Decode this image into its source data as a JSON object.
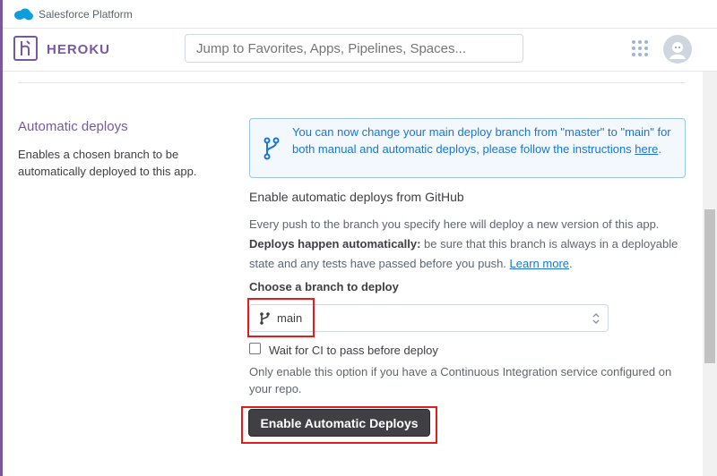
{
  "salesforce_bar": {
    "title": "Salesforce Platform",
    "icon": "salesforce-cloud-icon",
    "color": "#0d9dda"
  },
  "heroku_header": {
    "brand": "HEROKU",
    "logo_icon": "heroku-logo-icon",
    "brand_color": "#79589f",
    "search": {
      "placeholder": "Jump to Favorites, Apps, Pipelines, Spaces..."
    },
    "apps_icon": "apps-grid-icon",
    "avatar_icon": "user-avatar-icon"
  },
  "section": {
    "title": "Automatic deploys",
    "description": "Enables a chosen branch to be automatically deployed to this app."
  },
  "info_banner": {
    "icon": "git-branch-icon",
    "text": "You can now change your main deploy branch from \"master\" to \"main\" for both manual and automatic deploys, please follow the instructions ",
    "link": "here",
    "period": "."
  },
  "github": {
    "heading": "Enable automatic deploys from GitHub",
    "intro": "Every push to the branch you specify here will deploy a new version of this app.",
    "bold": "Deploys happen automatically:",
    "rest": " be sure that this branch is always in a deployable state and any tests have passed before you push. ",
    "learn_more": "Learn more",
    "learn_period": "."
  },
  "branch": {
    "label": "Choose a branch to deploy",
    "value": "main",
    "icon": "git-branch-icon",
    "arrows_icon": "select-arrows-icon"
  },
  "ci": {
    "checked": false,
    "label": "Wait for CI to pass before deploy",
    "note": "Only enable this option if you have a Continuous Integration service configured on your repo."
  },
  "button": {
    "label": "Enable Automatic Deploys"
  },
  "highlight_color": "#e11d1d"
}
